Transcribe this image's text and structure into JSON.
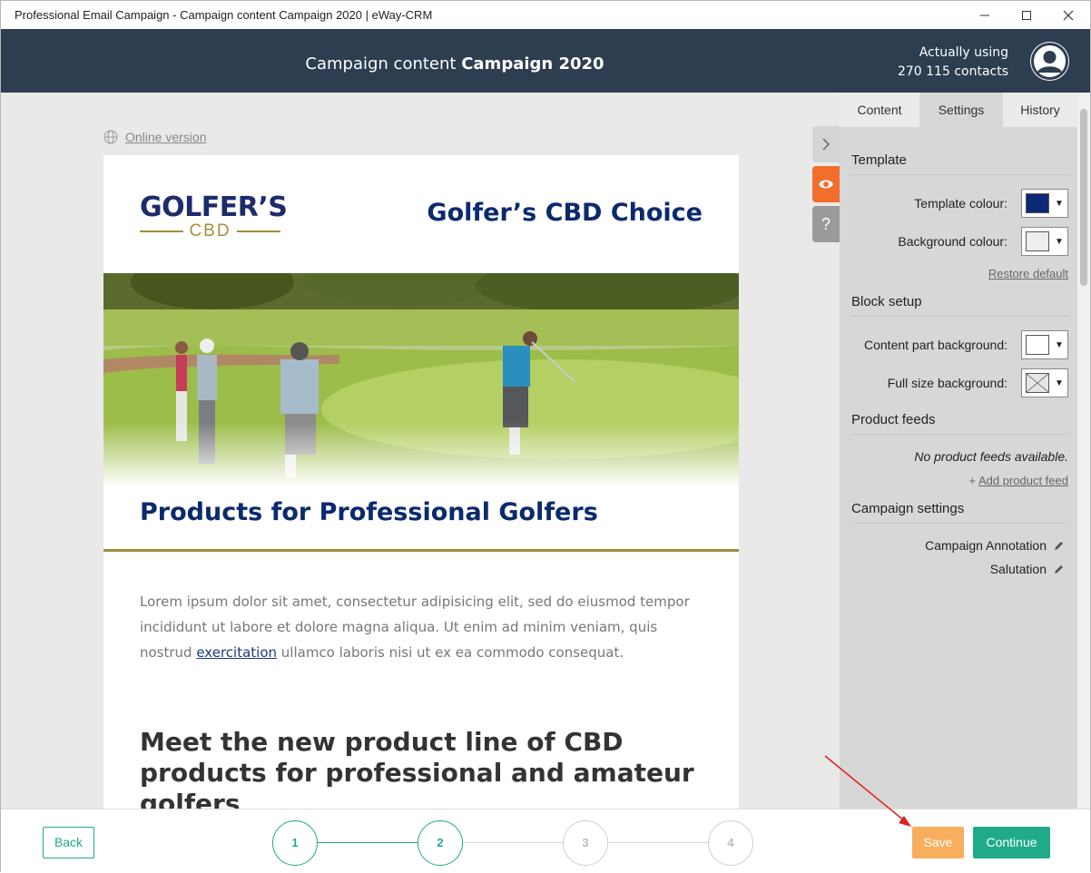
{
  "window": {
    "title": "Professional Email Campaign - Campaign content Campaign 2020 | eWay-CRM",
    "controls": [
      "minimize-icon",
      "maximize-icon",
      "close-icon"
    ]
  },
  "header": {
    "title_prefix": "Campaign content",
    "title_name": "Campaign 2020",
    "using_line1": "Actually using",
    "using_line2": "270 115 contacts",
    "avatar_icon": "user-icon"
  },
  "editor": {
    "online_link": "Online version",
    "email": {
      "logo_top": "GOLFER’S",
      "logo_bottom": "CBD",
      "brand_title": "Golfer’s CBD Choice",
      "headline": "Products for Professional Golfers",
      "body_before": "Lorem ipsum dolor sit amet, consectetur adipisicing elit, sed do eiusmod tempor incididunt ut labore et dolore magna aliqua. Ut enim ad minim veniam, quis nostrud ",
      "body_link": "exercitation",
      "body_after": " ullamco laboris nisi ut ex ea commodo consequat.",
      "subheadline": "Meet the new product line of CBD products for professional and amateur golfers"
    },
    "side_tools": [
      {
        "icon": "chevron-right-icon",
        "symbol": "›",
        "color": "#d4d4d4",
        "fg": "#666"
      },
      {
        "icon": "eye-icon",
        "symbol": "◉",
        "color": "#f26e2d",
        "fg": "#fff"
      },
      {
        "icon": "help-icon",
        "symbol": "?",
        "color": "#9a9a9a",
        "fg": "#fff"
      }
    ]
  },
  "panel": {
    "tabs": [
      "Content",
      "Settings",
      "History"
    ],
    "active_tab": "Settings",
    "template": {
      "heading": "Template",
      "template_colour_label": "Template colour:",
      "template_colour": "#0c2a74",
      "background_colour_label": "Background colour:",
      "background_colour": "#eeeeee",
      "restore_default": "Restore default"
    },
    "block_setup": {
      "heading": "Block setup",
      "content_part_label": "Content part background:",
      "content_part_colour": "#ffffff",
      "full_size_label": "Full size background:"
    },
    "product_feeds": {
      "heading": "Product feeds",
      "empty_text": "No product feeds available.",
      "add_link": "Add product feed"
    },
    "campaign_settings": {
      "heading": "Campaign settings",
      "items": [
        "Campaign Annotation",
        "Salutation"
      ]
    }
  },
  "footer": {
    "back": "Back",
    "steps": [
      "1",
      "2",
      "3",
      "4"
    ],
    "current_step": 2,
    "save": "Save",
    "continue": "Continue"
  },
  "colors": {
    "header_bg": "#2c3e50",
    "accent_green": "#1fab89",
    "save_orange": "#f8ae5c",
    "annotation_arrow": "#e02020"
  }
}
